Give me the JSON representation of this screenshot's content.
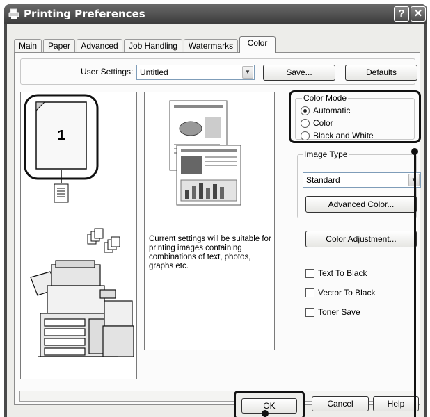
{
  "window": {
    "title": "Printing Preferences"
  },
  "titlebar": {
    "help_glyph": "?",
    "close_glyph": "✕"
  },
  "tabs": [
    {
      "label": "Main"
    },
    {
      "label": "Paper"
    },
    {
      "label": "Advanced"
    },
    {
      "label": "Job Handling"
    },
    {
      "label": "Watermarks"
    },
    {
      "label": "Color",
      "active": true
    }
  ],
  "user_settings": {
    "label": "User Settings:",
    "value": "Untitled",
    "save_label": "Save...",
    "defaults_label": "Defaults"
  },
  "preview": {
    "page_number": "1"
  },
  "description": {
    "text": "Current settings will be suitable for printing images containing combinations of text, photos, graphs etc."
  },
  "color_mode": {
    "legend": "Color Mode",
    "options": [
      "Automatic",
      "Color",
      "Black and White"
    ],
    "selected": "Automatic"
  },
  "image_type": {
    "legend": "Image Type",
    "value": "Standard",
    "advanced_label": "Advanced Color..."
  },
  "color_adjustment": {
    "label": "Color Adjustment..."
  },
  "checkboxes": [
    {
      "label": "Text To Black",
      "checked": false
    },
    {
      "label": "Vector To Black",
      "checked": false
    },
    {
      "label": "Toner Save",
      "checked": false
    }
  ],
  "buttons": {
    "ok": "OK",
    "cancel": "Cancel",
    "help": "Help"
  }
}
